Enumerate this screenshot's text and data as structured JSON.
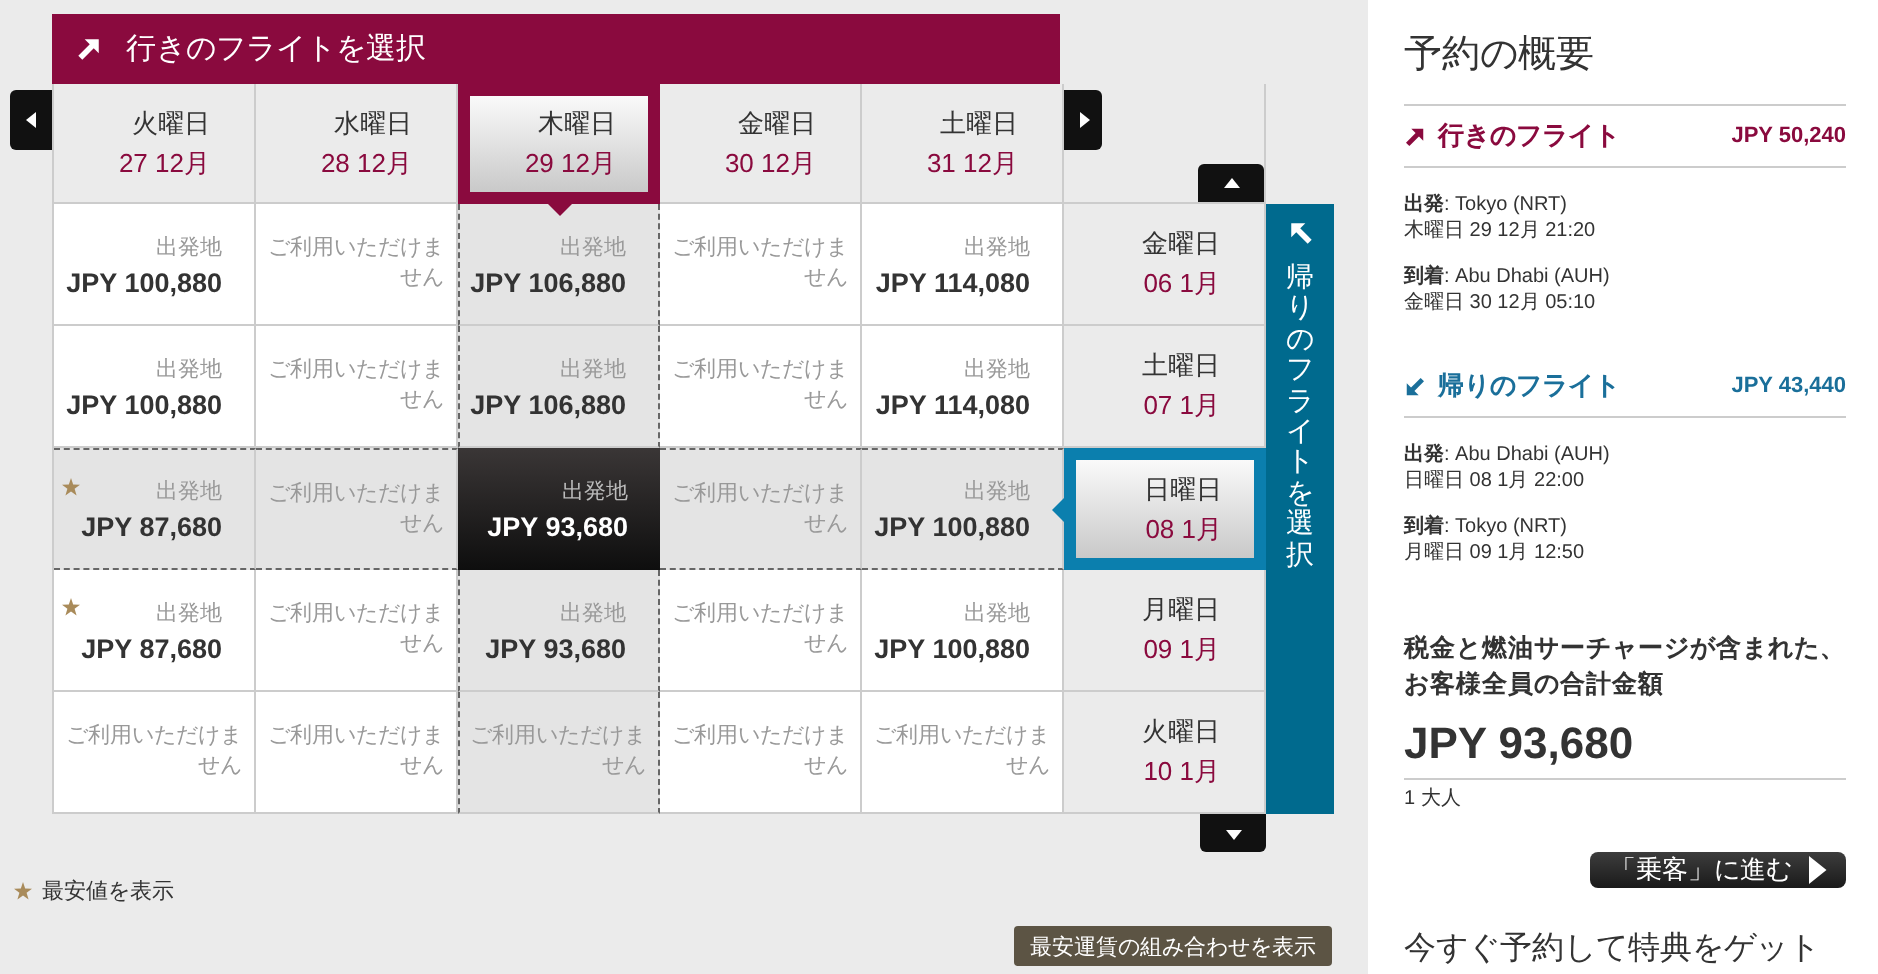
{
  "outbound": {
    "title": "行きのフライトを選択",
    "dates": [
      {
        "weekday": "火曜日",
        "date": "27 12月",
        "selected": false
      },
      {
        "weekday": "水曜日",
        "date": "28 12月",
        "selected": false
      },
      {
        "weekday": "木曜日",
        "date": "29 12月",
        "selected": true
      },
      {
        "weekday": "金曜日",
        "date": "30 12月",
        "selected": false
      },
      {
        "weekday": "土曜日",
        "date": "31 12月",
        "selected": false
      }
    ]
  },
  "return": {
    "title": "帰りのフライトを選択",
    "dates": [
      {
        "weekday": "金曜日",
        "date": "06 1月",
        "selected": false
      },
      {
        "weekday": "土曜日",
        "date": "07 1月",
        "selected": false
      },
      {
        "weekday": "日曜日",
        "date": "08 1月",
        "selected": true
      },
      {
        "weekday": "月曜日",
        "date": "09 1月",
        "selected": false
      },
      {
        "weekday": "火曜日",
        "date": "10 1月",
        "selected": false
      }
    ]
  },
  "fares": [
    [
      {
        "kind": "fare",
        "label": "出発地",
        "price": "JPY 100,880",
        "lowest": false
      },
      {
        "kind": "unavailable",
        "text": "ご利用いただけません"
      },
      {
        "kind": "fare",
        "label": "出発地",
        "price": "JPY 106,880",
        "lowest": false
      },
      {
        "kind": "unavailable",
        "text": "ご利用いただけません"
      },
      {
        "kind": "fare",
        "label": "出発地",
        "price": "JPY 114,080",
        "lowest": false
      }
    ],
    [
      {
        "kind": "fare",
        "label": "出発地",
        "price": "JPY 100,880",
        "lowest": false
      },
      {
        "kind": "unavailable",
        "text": "ご利用いただけません"
      },
      {
        "kind": "fare",
        "label": "出発地",
        "price": "JPY 106,880",
        "lowest": false
      },
      {
        "kind": "unavailable",
        "text": "ご利用いただけません"
      },
      {
        "kind": "fare",
        "label": "出発地",
        "price": "JPY 114,080",
        "lowest": false
      }
    ],
    [
      {
        "kind": "fare",
        "label": "出発地",
        "price": "JPY 87,680",
        "lowest": true
      },
      {
        "kind": "unavailable",
        "text": "ご利用いただけません"
      },
      {
        "kind": "fare",
        "label": "出発地",
        "price": "JPY 93,680",
        "lowest": false
      },
      {
        "kind": "unavailable",
        "text": "ご利用いただけません"
      },
      {
        "kind": "fare",
        "label": "出発地",
        "price": "JPY 100,880",
        "lowest": false
      }
    ],
    [
      {
        "kind": "fare",
        "label": "出発地",
        "price": "JPY 87,680",
        "lowest": true
      },
      {
        "kind": "unavailable",
        "text": "ご利用いただけません"
      },
      {
        "kind": "fare",
        "label": "出発地",
        "price": "JPY 93,680",
        "lowest": false
      },
      {
        "kind": "unavailable",
        "text": "ご利用いただけません"
      },
      {
        "kind": "fare",
        "label": "出発地",
        "price": "JPY 100,880",
        "lowest": false
      }
    ],
    [
      {
        "kind": "unavailable",
        "text": "ご利用いただけません"
      },
      {
        "kind": "unavailable",
        "text": "ご利用いただけません"
      },
      {
        "kind": "unavailable",
        "text": "ご利用いただけません"
      },
      {
        "kind": "unavailable",
        "text": "ご利用いただけません"
      },
      {
        "kind": "unavailable",
        "text": "ご利用いただけません"
      }
    ]
  ],
  "legend": "最安値を表示",
  "combo_button": "最安運賃の組み合わせを表示",
  "summary": {
    "title": "予約の概要",
    "flights": [
      {
        "kind": "outbound",
        "title": "行きのフライト",
        "price": "JPY 50,240",
        "stops": [
          [
            "**出発**: Tokyo (NRT)",
            "木曜日 29 12月 21:20"
          ],
          [
            "**到着**: Abu Dhabi (AUH)",
            "金曜日 30 12月 05:10"
          ]
        ]
      },
      {
        "kind": "return",
        "title": "帰りのフライト",
        "price": "JPY 43,440",
        "stops": [
          [
            "**出発**: Abu Dhabi (AUH)",
            "日曜日 08 1月 22:00"
          ],
          [
            "**到着**: Tokyo (NRT)",
            "月曜日 09 1月 12:50"
          ]
        ]
      }
    ],
    "total_label": "税金と燃油サーチャージが含まれた、お客様全員の合計金額",
    "total_price": "JPY 93,680",
    "travellers": "1 大人",
    "proceed_button": "「乗客」に進む",
    "promo": "今すぐ予約して特典をゲット"
  }
}
